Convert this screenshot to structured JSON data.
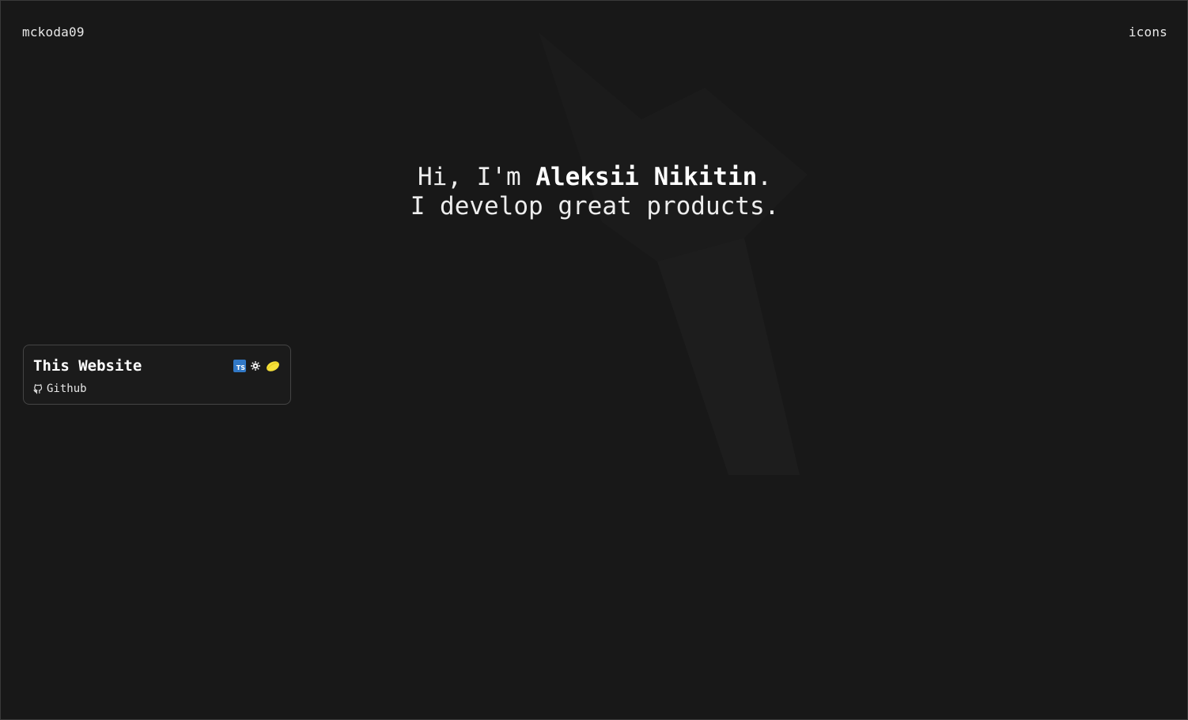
{
  "header": {
    "brand": "mckoda09",
    "nav_link": "icons"
  },
  "hero": {
    "greeting_prefix": "Hi, I'm ",
    "name": "Aleksii Nikitin",
    "greeting_suffix": ".",
    "tagline": "I develop great products."
  },
  "projects": [
    {
      "title": "This Website",
      "tech_icons": [
        "typescript-icon",
        "solid-icon",
        "lemon-icon"
      ],
      "typescript_badge": "TS",
      "link_icon": "github-icon",
      "link_label": "Github"
    }
  ],
  "colors": {
    "background": "#181818",
    "text": "#ececec",
    "card_border": "#454545",
    "typescript": "#3178c6",
    "lemon": "#f5e03a"
  }
}
